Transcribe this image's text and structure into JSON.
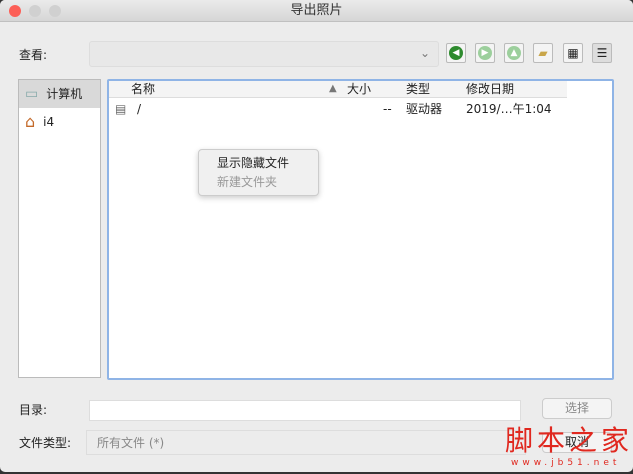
{
  "window": {
    "title": "导出照片"
  },
  "look_in": {
    "label": "查看:",
    "value": ""
  },
  "sidebar": {
    "items": [
      {
        "label": "计算机"
      },
      {
        "label": "i4"
      }
    ]
  },
  "table": {
    "headers": [
      "名称",
      "大小",
      "类型",
      "修改日期"
    ],
    "rows": [
      {
        "name": "/",
        "size": "--",
        "type": "驱动器",
        "modified": "2019/…午1:04"
      }
    ]
  },
  "context_menu": {
    "items": [
      {
        "label": "显示隐藏文件",
        "enabled": true
      },
      {
        "label": "新建文件夹",
        "enabled": false
      }
    ]
  },
  "directory": {
    "label": "目录:",
    "value": ""
  },
  "filetype": {
    "label": "文件类型:",
    "value": "所有文件 (*)"
  },
  "buttons": {
    "choose": "选择",
    "cancel": "取消"
  },
  "watermark": {
    "text": "脚本之家",
    "url": "www.jb51.net"
  }
}
